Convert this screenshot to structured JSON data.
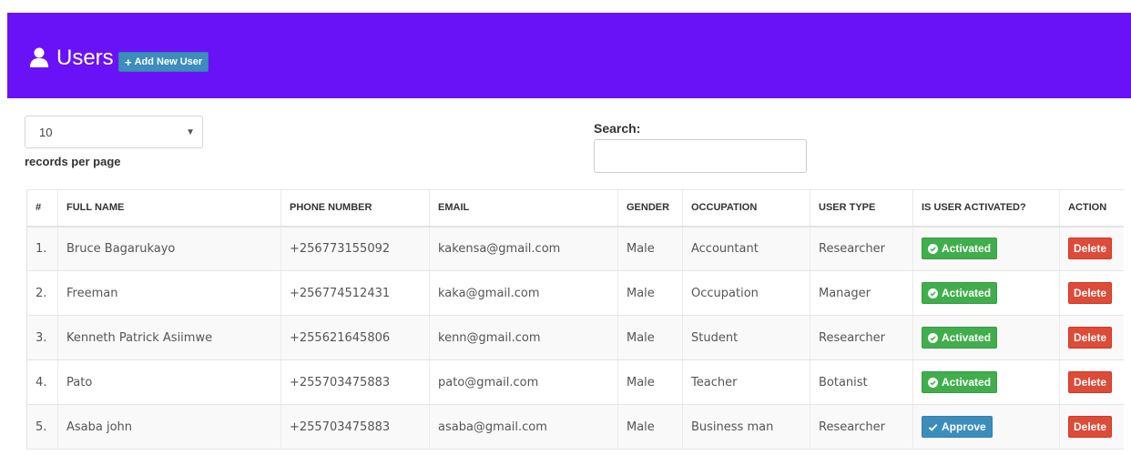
{
  "header": {
    "title": "Users",
    "add_button": "Add New User",
    "background": "#6a12f7"
  },
  "controls": {
    "page_length_value": "10",
    "page_length_label": "records per page",
    "search_label": "Search:",
    "search_value": ""
  },
  "table": {
    "columns": [
      "#",
      "FULL NAME",
      "PHONE NUMBER",
      "EMAIL",
      "GENDER",
      "OCCUPATION",
      "USER TYPE",
      "IS USER ACTIVATED?",
      "ACTION"
    ],
    "rows": [
      {
        "num": "1.",
        "name": "Bruce Bagarukayo",
        "phone": "+256773155092",
        "email": "kakensa@gmail.com",
        "gender": "Male",
        "occupation": "Accountant",
        "user_type": "Researcher",
        "status": "Activated",
        "status_kind": "activated",
        "action": "Delete"
      },
      {
        "num": "2.",
        "name": "Freeman",
        "phone": "+256774512431",
        "email": "kaka@gmail.com",
        "gender": "Male",
        "occupation": "Occupation",
        "user_type": "Manager",
        "status": "Activated",
        "status_kind": "activated",
        "action": "Delete"
      },
      {
        "num": "3.",
        "name": "Kenneth Patrick Asiimwe",
        "phone": "+255621645806",
        "email": "kenn@gmail.com",
        "gender": "Male",
        "occupation": "Student",
        "user_type": "Researcher",
        "status": "Activated",
        "status_kind": "activated",
        "action": "Delete"
      },
      {
        "num": "4.",
        "name": "Pato",
        "phone": "+255703475883",
        "email": "pato@gmail.com",
        "gender": "Male",
        "occupation": "Teacher",
        "user_type": "Botanist",
        "status": "Activated",
        "status_kind": "activated",
        "action": "Delete"
      },
      {
        "num": "5.",
        "name": "Asaba john",
        "phone": "+255703475883",
        "email": "asaba@gmail.com",
        "gender": "Male",
        "occupation": "Business man",
        "user_type": "Researcher",
        "status": "Approve",
        "status_kind": "approve",
        "action": "Delete"
      }
    ]
  },
  "colors": {
    "activated": "#40ae4c",
    "approve": "#3c8dbc",
    "delete": "#dd4b39",
    "add_button": "#3c8dbc"
  }
}
